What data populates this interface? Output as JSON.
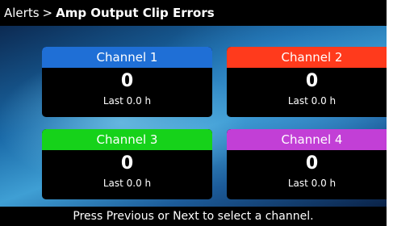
{
  "header": {
    "breadcrumb": "Alerts",
    "separator": ">",
    "title": "Amp Output Clip Errors"
  },
  "channels": [
    {
      "label": "Channel 1",
      "count": "0",
      "last": "Last 0.0 h",
      "color": "#1f6fd6"
    },
    {
      "label": "Channel 2",
      "count": "0",
      "last": "Last 0.0 h",
      "color": "#ff3a1c"
    },
    {
      "label": "Channel 3",
      "count": "0",
      "last": "Last 0.0 h",
      "color": "#16d21a"
    },
    {
      "label": "Channel 4",
      "count": "0",
      "last": "Last 0.0 h",
      "color": "#c23fd6"
    }
  ],
  "footer": {
    "hint": "Press Previous or Next to select a channel."
  }
}
